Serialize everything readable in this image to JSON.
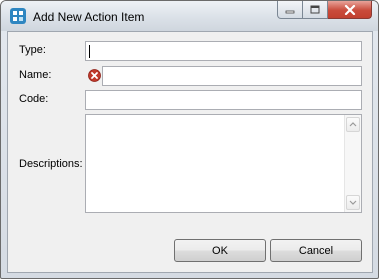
{
  "window": {
    "title": "Add New Action Item",
    "controls": {
      "minimize": "minimize-icon",
      "maximize": "maximize-icon",
      "close": "close-icon"
    },
    "app_icon": "app-icon"
  },
  "form": {
    "type": {
      "label": "Type:",
      "value": ""
    },
    "name": {
      "label": "Name:",
      "value": "",
      "error_icon": "error-icon"
    },
    "code": {
      "label": "Code:",
      "value": ""
    },
    "descriptions": {
      "label": "Descriptions:",
      "value": ""
    }
  },
  "buttons": {
    "ok": "OK",
    "cancel": "Cancel"
  },
  "colors": {
    "error": "#c0392b",
    "close_button": "#c94b3b",
    "app_icon": "#2e86c1"
  }
}
